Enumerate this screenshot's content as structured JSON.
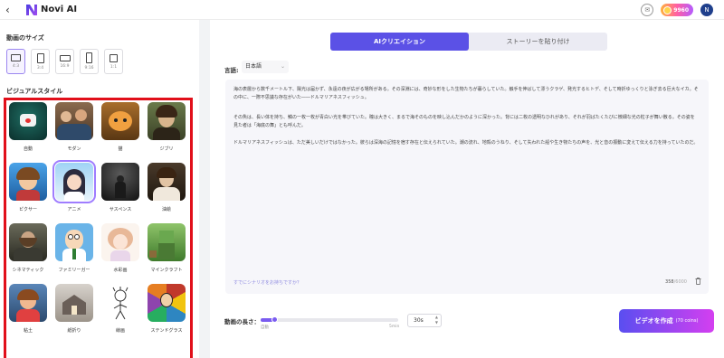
{
  "header": {
    "back_glyph": "‹",
    "app_title": "Novi AI",
    "message_glyph": "✉",
    "credits": "9960",
    "avatar_letter": "N"
  },
  "left": {
    "size_label": "動画のサイズ",
    "sizes": [
      {
        "label": "4:3",
        "selected": true
      },
      {
        "label": "3:4",
        "selected": false
      },
      {
        "label": "16:9",
        "selected": false
      },
      {
        "label": "9:16",
        "selected": false
      },
      {
        "label": "1:1",
        "selected": false
      }
    ],
    "style_label": "ビジュアルスタイル",
    "styles": [
      {
        "name": "自動",
        "selected": false
      },
      {
        "name": "モダン",
        "selected": false
      },
      {
        "name": "猫",
        "selected": false
      },
      {
        "name": "ジブリ",
        "selected": false
      },
      {
        "name": "ピクサー",
        "selected": false
      },
      {
        "name": "アニメ",
        "selected": true
      },
      {
        "name": "サスペンス",
        "selected": false
      },
      {
        "name": "油絵",
        "selected": false
      },
      {
        "name": "シネマティック",
        "selected": false
      },
      {
        "name": "ファミリーガー",
        "selected": false
      },
      {
        "name": "水彩画",
        "selected": false
      },
      {
        "name": "マインクラフト",
        "selected": false
      },
      {
        "name": "粘土",
        "selected": false
      },
      {
        "name": "紙折り",
        "selected": false
      },
      {
        "name": "線画",
        "selected": false
      },
      {
        "name": "ステンドグラス",
        "selected": false
      }
    ]
  },
  "tabs": {
    "active": "AIクリエイション",
    "inactive": "ストーリーを貼り付け"
  },
  "language": {
    "label": "言語:",
    "value": "日本語"
  },
  "story": {
    "paragraphs": [
      "海の表層から数千メートル下、陽光は届かず、永遠の夜が広がる場所がある。その深淵には、奇妙な形をした生物たちが暮らしていた。触手を伸ばして漂うクラゲ、発光するヒトデ、そして時折ゆっくりと泳ぎ去る巨大なイカ。その中に、一際不思議な存在がいた――ドルマリアネスフィッシュ。",
      "その魚は、長い体を持ち、鱗の一枚一枚が青白い光を帯びていた。瞳は大きく、まるで海そのものを映し込んだかのように深かった。背には二枚の透明なひれがあり、それが羽ばたくたびに微細な光の粒子が舞い散る。その姿を見た者は「海底の舞」とも呼んだ。",
      "ドルマリアネスフィッシュは、ただ美しいだけではなかった。彼らは深海の記憶を宿す存在と伝えられていた。潮の流れ、地殻のうねり、そして失われた船や生き物たちの声を、光と音の振動に変えて伝える力を持っていたのだ。"
    ],
    "hint": "すでにシナリオをお持ちですか？",
    "count": "358",
    "max": "/6000"
  },
  "length": {
    "label": "動画の長さ：",
    "min_label": "自動",
    "max_label": "5min",
    "value": "30s",
    "fraction": 0.1
  },
  "generate": {
    "label": "ビデオを作成",
    "cost": "(70 coins)"
  },
  "colors": {
    "accent": "#5b51e6",
    "highlight_border": "#e10f1a"
  }
}
